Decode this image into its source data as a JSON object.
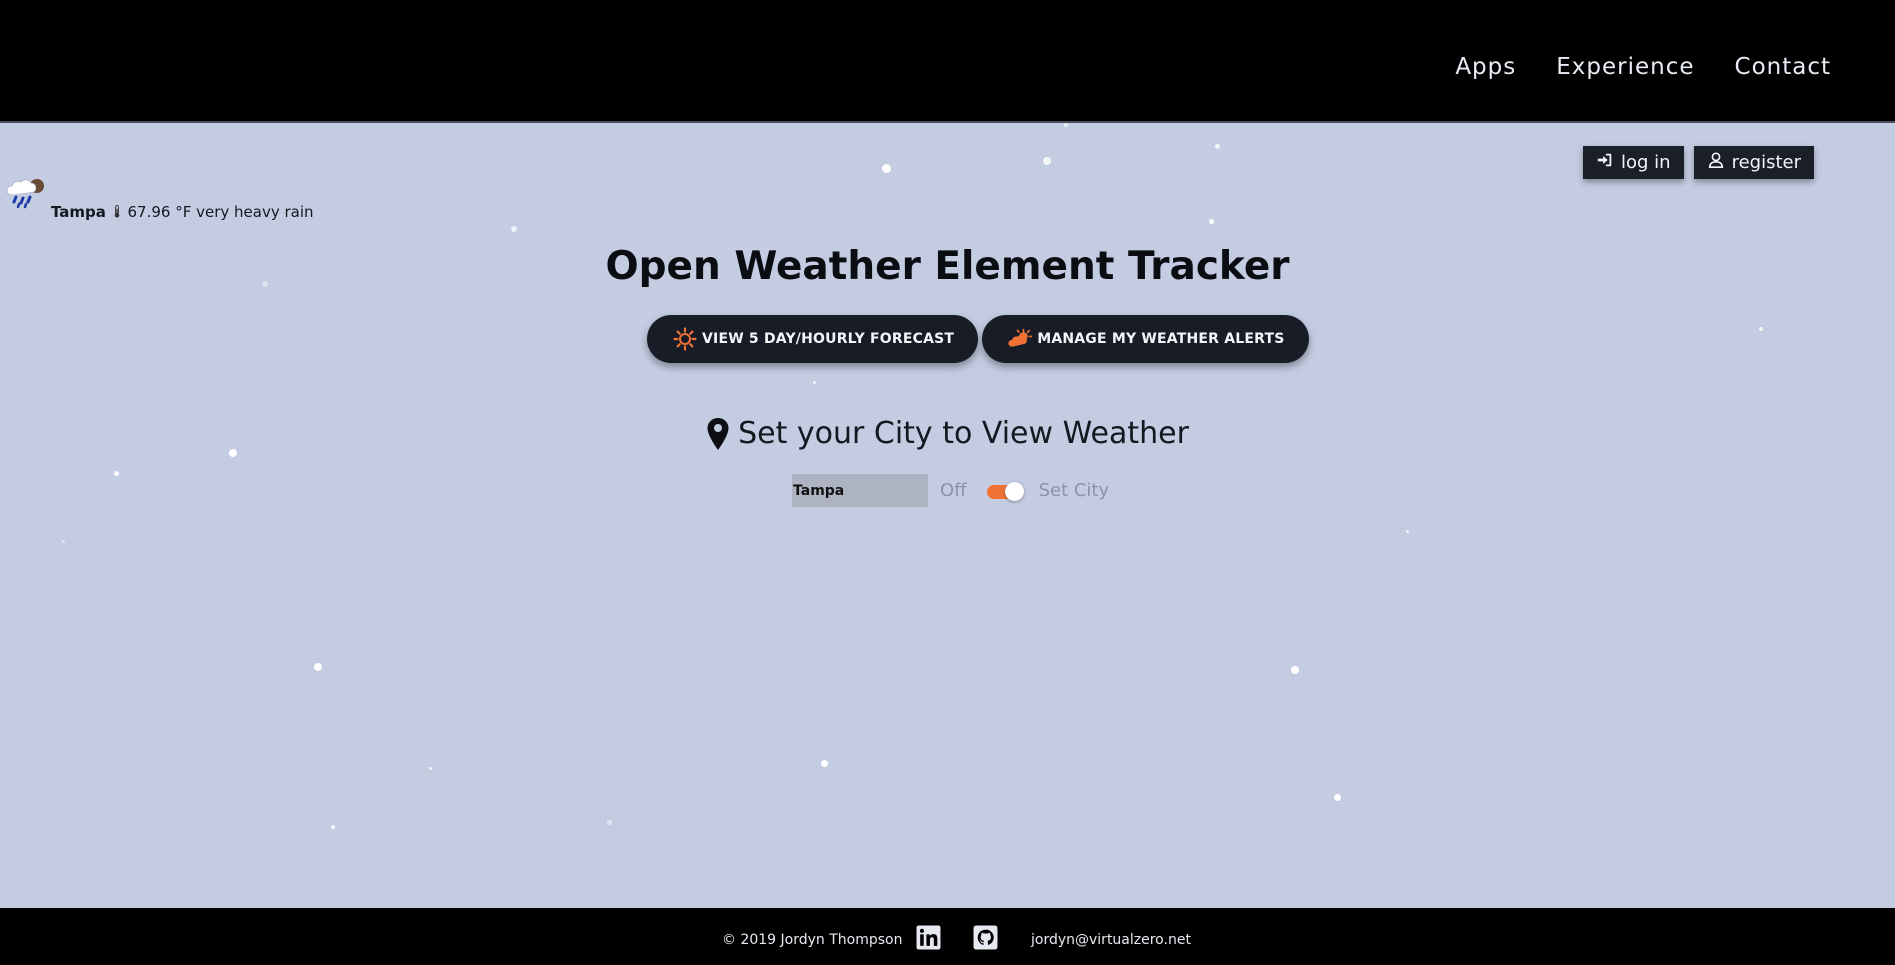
{
  "nav": {
    "links": [
      "Apps",
      "Experience",
      "Contact"
    ]
  },
  "auth": {
    "login_label": "log in",
    "register_label": "register"
  },
  "current_weather": {
    "city": "Tampa",
    "temperature": "67.96 °F",
    "description": "very heavy rain",
    "icon": "rain-cloud-icon"
  },
  "page_title": "Open Weather Element Tracker",
  "buttons": {
    "forecast": {
      "label": "VIEW 5 DAY/HOURLY FORECAST",
      "icon": "sun-gear-icon"
    },
    "alerts": {
      "label": "MANAGE MY WEATHER ALERTS",
      "icon": "cloud-sun-icon"
    }
  },
  "set_city": {
    "heading": "Set your City to View Weather",
    "input_value": "Tampa",
    "toggle_off_label": "Off",
    "toggle_on_label": "Set City",
    "toggle_state": "on"
  },
  "footer": {
    "copyright": "© 2019 Jordyn Thompson",
    "email": "jordyn@virtualzero.net",
    "icons": [
      "linkedin-icon",
      "github-icon"
    ]
  },
  "colors": {
    "background": "#c3cce1",
    "nav_background": "#000000",
    "button_dark": "#171c26",
    "accent_orange": "#f07335"
  }
}
